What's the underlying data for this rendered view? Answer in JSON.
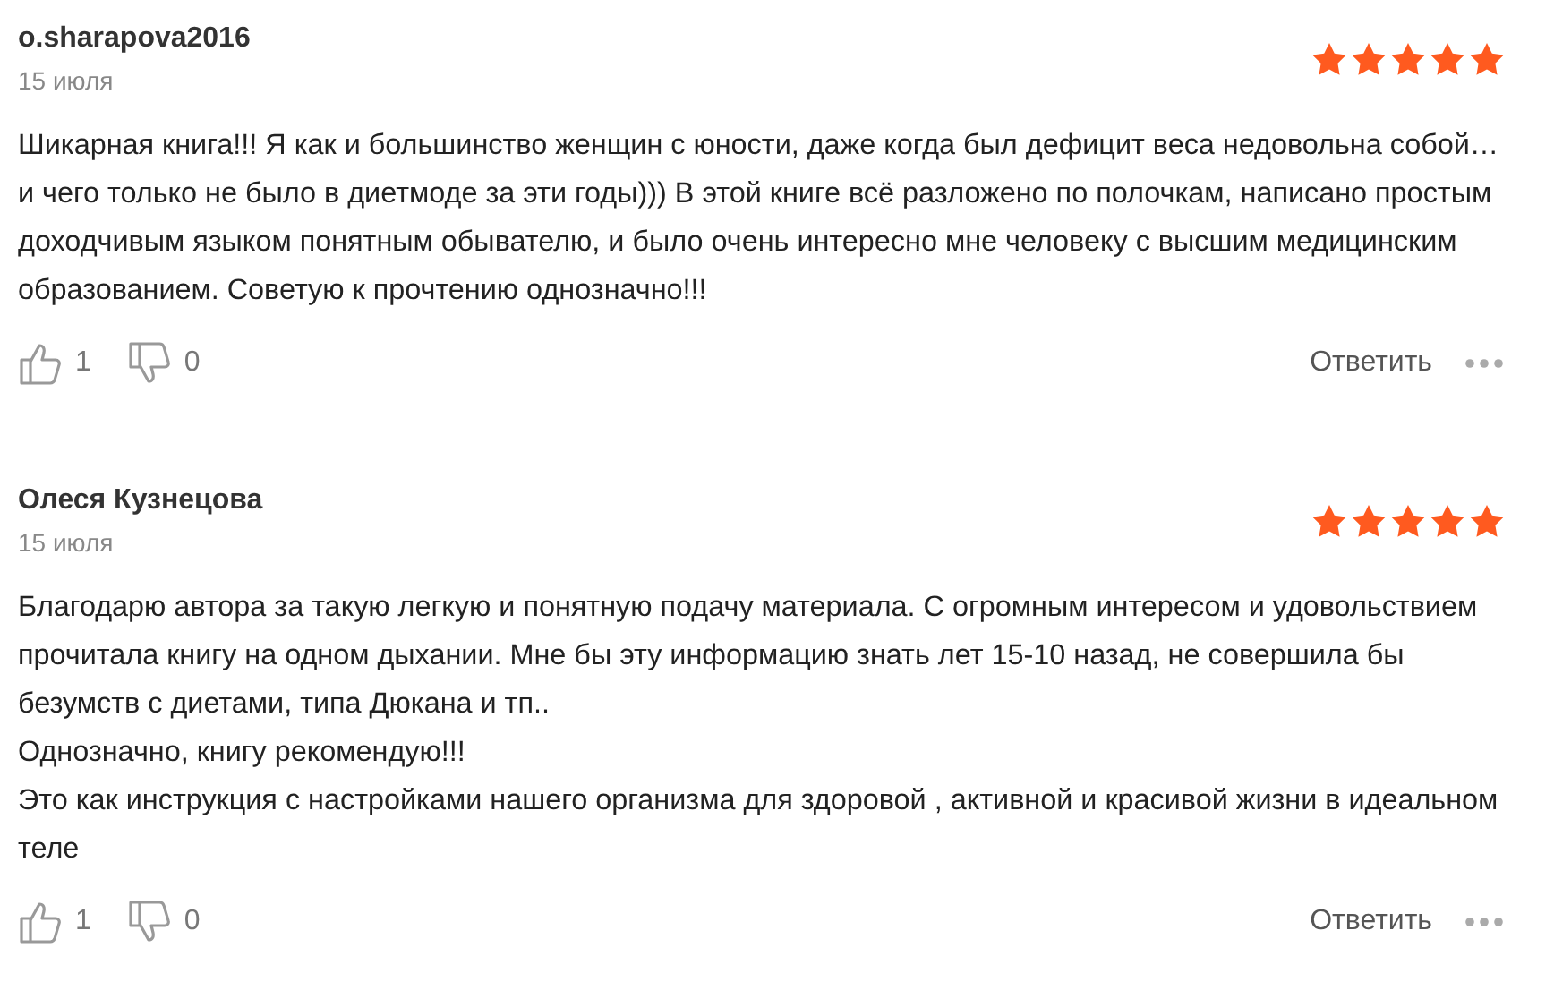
{
  "reviews": [
    {
      "author": "o.sharapova2016",
      "date": "15 июля",
      "stars": 5,
      "paragraphs": [
        "Шикарная книга!!! Я как и большинство женщин с юности, даже когда был дефицит веса недовольна собой… и чего только не было в диетмоде за эти годы))) В этой книге всё разложено по полочкам, написано простым доходчивым языком понятным обывателю, и было очень интересно мне человеку с высшим медицинским образованием. Советую к прочтению однозначно!!!"
      ],
      "likes": "1",
      "dislikes": "0",
      "reply": "Ответить"
    },
    {
      "author": "Олеся Кузнецова",
      "date": "15 июля",
      "stars": 5,
      "paragraphs": [
        "Благодарю автора за такую легкую и понятную подачу материала. С огромным интересом и удовольствием прочитала книгу на одном дыхании. Мне бы эту информацию знать лет 15-10 назад, не совершила бы безумств с диетами, типа Дюкана и тп..",
        "Однозначно, книгу рекомендую!!!",
        "Это как инструкция с настройками нашего организма для здоровой , активной и красивой жизни в идеальном теле"
      ],
      "likes": "1",
      "dislikes": "0",
      "reply": "Ответить"
    }
  ]
}
